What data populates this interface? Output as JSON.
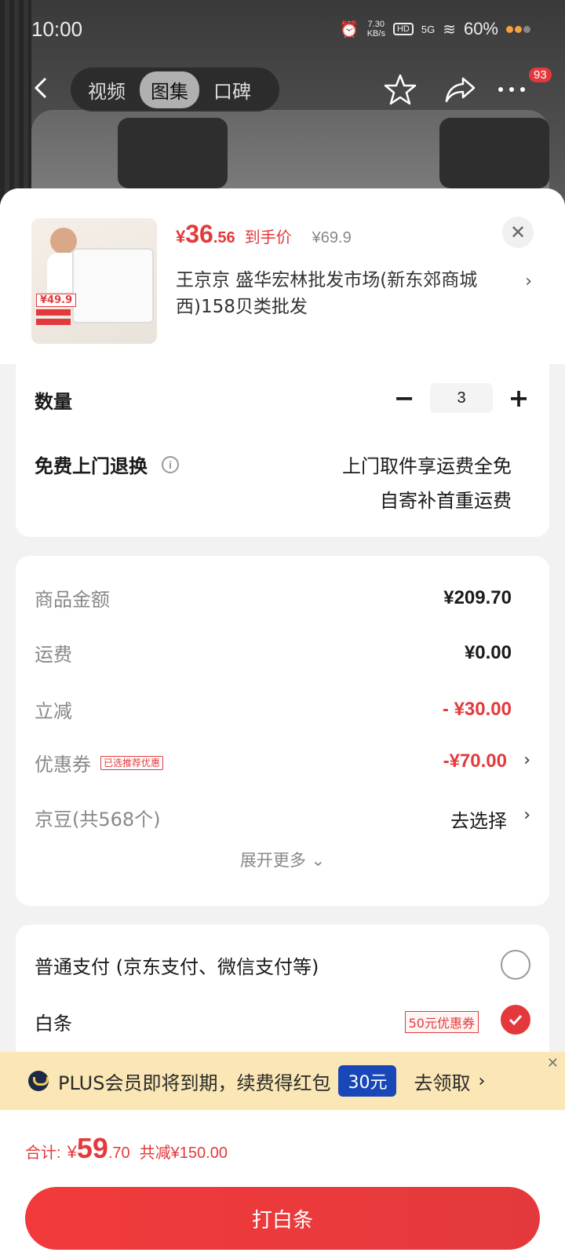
{
  "status_bar": {
    "time": "10:00",
    "net_speed": "7.30",
    "net_unit": "KB/s",
    "hd": "HD",
    "signal": "5G",
    "battery": "60%"
  },
  "nav": {
    "tabs": [
      "视频",
      "图集",
      "口碑"
    ],
    "active_tab": 1,
    "badge": "93"
  },
  "product": {
    "price_currency": "¥",
    "price_int": "36",
    "price_dec": ".56",
    "price_label": "到手价",
    "original_price": "¥69.9",
    "shop": "王京京 盛华宏林批发市场(新东郊商城西)158贝类批发",
    "thumb_price": "49.9"
  },
  "options": {
    "qty_label": "数量",
    "qty_value": "3",
    "minus": "−",
    "plus": "+",
    "return_label": "免费上门退换",
    "return_info": "i",
    "return_line1": "上门取件享运费全免",
    "return_line2": "自寄补首重运费"
  },
  "summary": {
    "goods_label": "商品金额",
    "goods_value": "¥209.70",
    "ship_label": "运费",
    "ship_value": "¥0.00",
    "discount_label": "立减",
    "discount_value": "- ¥30.00",
    "coupon_label": "优惠券",
    "coupon_tag": "已选推荐优惠",
    "coupon_value": "-¥70.00",
    "beans_label": "京豆(共568个)",
    "beans_value": "去选择",
    "more": "展开更多 ⌄"
  },
  "payment": {
    "normal_label": "普通支付 (京东支付、微信支付等)",
    "baitiao_label": "白条",
    "baitiao_coupon": "50元优惠券"
  },
  "plus_banner": {
    "text": "PLUS会员即将到期，续费得红包",
    "amount": "30元",
    "action": "去领取"
  },
  "footer": {
    "total_label": "合计:",
    "total_cur": "¥",
    "total_int": "59",
    "total_dec": ".70",
    "total_save": "共减¥150.00",
    "pay_button": "打白条"
  },
  "colors": {
    "accent": "#e4393c",
    "plus_bg": "#fbe6b5",
    "plus_amount": "#1947b8"
  }
}
